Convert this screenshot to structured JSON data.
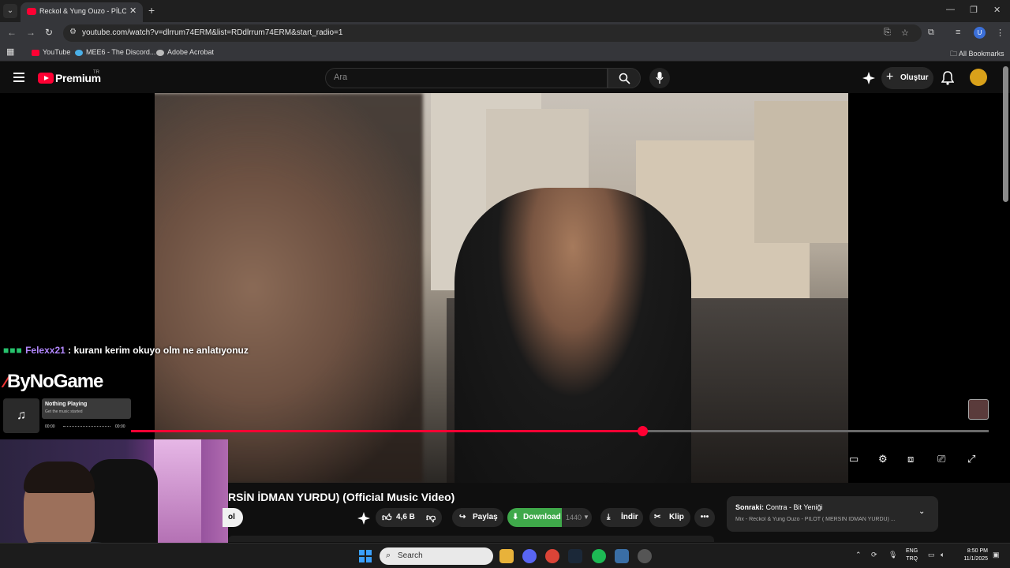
{
  "browser": {
    "tab_title": "Reckol & Yung Ouzo - PİLOT ( M",
    "url": "youtube.com/watch?v=dlrrum74ERM&list=RDdlrrum74ERM&start_radio=1",
    "bookmarks": [
      "YouTube",
      "MEE6 - The Discord...",
      "Adobe Acrobat"
    ],
    "all_bookmarks": "All Bookmarks",
    "profile_initial": "U"
  },
  "youtube": {
    "brand": "Premium",
    "region": "TR",
    "search_placeholder": "Ara",
    "create_label": "Oluştur"
  },
  "overlay": {
    "chat_user": "Felexx21",
    "chat_message": ": kuranı kerim okuyo olm ne anlatıyonuz",
    "widget_brand": "ByNoGame",
    "now_playing_title": "Nothing Playing",
    "now_playing_sub": "Get the music started",
    "time_start": "00:00",
    "time_end": "00:00"
  },
  "player": {
    "progress_fraction": 0.596
  },
  "video": {
    "title_partial": "RSİN İDMAN YURDU) (Official Music Video)",
    "subscribe_partial": "ol",
    "like_count": "4,6 B",
    "share_label": "Paylaş",
    "download_label": "Download",
    "download_count": "1440",
    "indir_label": "İndir",
    "klip_label": "Klip",
    "more_label": "•••"
  },
  "next": {
    "prefix": "Sonraki:",
    "title": "Contra - Bit Yeniği",
    "mix": "Mix - Reckol & Yung Ouzo - PİLOT ( MERSİN İDMAN YURDU) ..."
  },
  "taskbar": {
    "search_label": "Search",
    "lang_top": "ENG",
    "lang_bottom": "TRQ",
    "time": "8:50 PM",
    "date": "11/1/2025"
  },
  "colors": {
    "accent_red": "#ff0033",
    "download_green": "#3fa94a",
    "chat_name": "#b388ff"
  }
}
